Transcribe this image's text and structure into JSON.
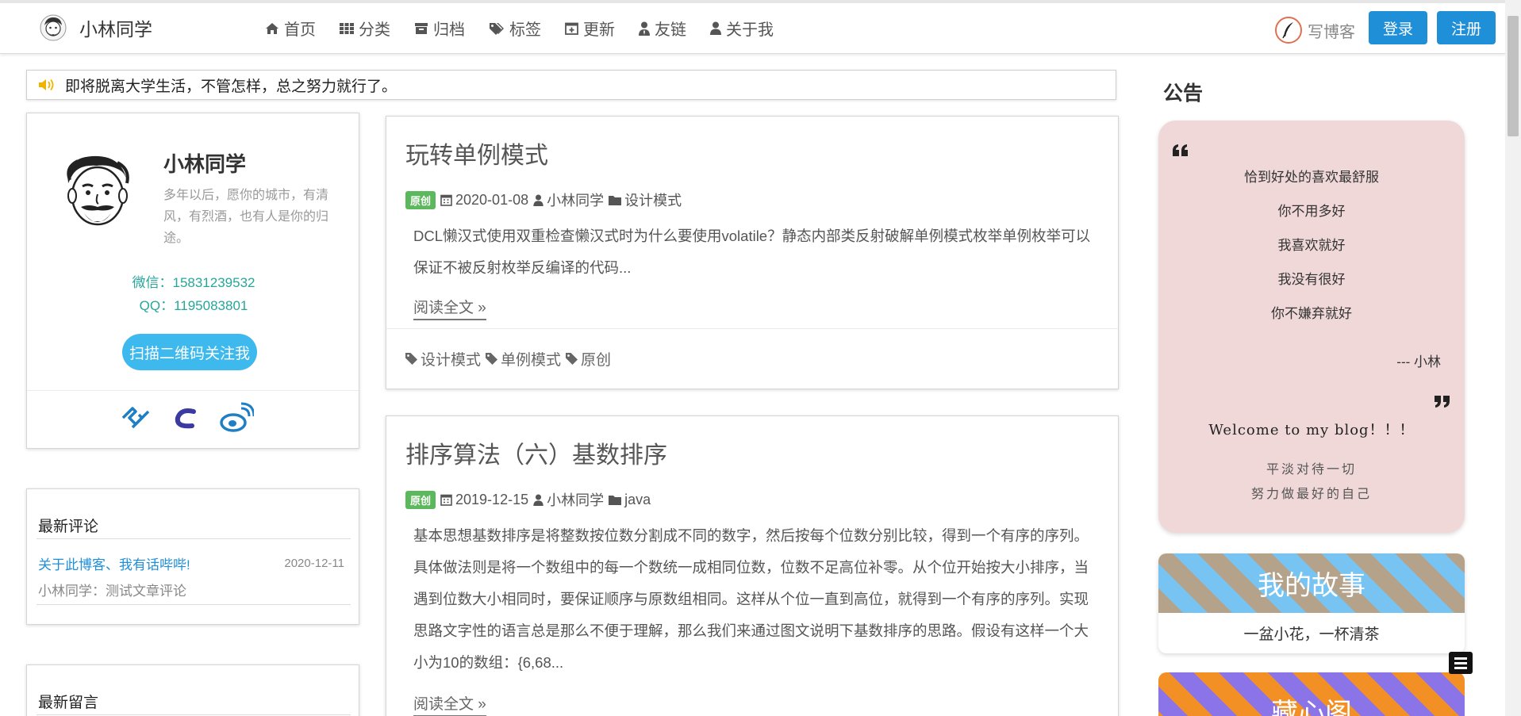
{
  "navbar": {
    "brand": "小林同学",
    "items": [
      {
        "label": "首页",
        "icon": "home-icon"
      },
      {
        "label": "分类",
        "icon": "grid-icon"
      },
      {
        "label": "归档",
        "icon": "archive-icon"
      },
      {
        "label": "标签",
        "icon": "tags-icon"
      },
      {
        "label": "更新",
        "icon": "calendar-plus-icon"
      },
      {
        "label": "友链",
        "icon": "user-tie-icon"
      },
      {
        "label": "关于我",
        "icon": "user-icon"
      }
    ],
    "write_label": "写博客",
    "login_label": "登录",
    "register_label": "注册"
  },
  "notice": {
    "text": "即将脱离大学生活，不管怎样，总之努力就行了。"
  },
  "profile": {
    "name": "小林同学",
    "motto": "多年以后，愿你的城市，有清风，有烈酒，也有人是你的归途。",
    "wechat": "微信：15831239532",
    "qq": "QQ：1195083801",
    "qr_button": "扫描二维码关注我"
  },
  "latest_comments": {
    "title": "最新评论",
    "link": "关于此博客、我有话哔哔!",
    "date": "2020-12-11",
    "text": "小林同学：测试文章评论"
  },
  "latest_messages": {
    "title": "最新留言"
  },
  "posts": [
    {
      "title": "玩转单例模式",
      "badge": "原创",
      "date": "2020-01-08",
      "author": "小林同学",
      "category": "设计模式",
      "excerpt": "DCL懒汉式使用双重检查懒汉式时为什么要使用volatile？静态内部类反射破解单例模式枚举单例枚举可以保证不被反射枚举反编译的代码...",
      "read_more": "阅读全文 »",
      "tags": [
        "设计模式",
        "单例模式",
        "原创"
      ]
    },
    {
      "title": "排序算法（六）基数排序",
      "badge": "原创",
      "date": "2019-12-15",
      "author": "小林同学",
      "category": "java",
      "excerpt": "基本思想基数排序是将整数按位数分割成不同的数字，然后按每个位数分别比较，得到一个有序的序列。具体做法则是将一个数组中的每一个数统一成相同位数，位数不足高位补零。从个位开始按大小排序，当遇到位数大小相同时，要保证顺序与原数组相同。这样从个位一直到高位，就得到一个有序的序列。实现思路文字性的语言总是那么不便于理解，那么我们来通过图文说明下基数排序的思路。假设有这样一个大小为10的数组：{6,68...",
      "read_more": "阅读全文 »"
    }
  ],
  "announcement": {
    "title": "公告",
    "lines": [
      "恰到好处的喜欢最舒服",
      "你不用多好",
      "我喜欢就好",
      "我没有很好",
      "你不嫌弃就好"
    ],
    "author": "--- 小林",
    "welcome": "Welcome to my blog！！！",
    "sub_1": "平淡对待一切",
    "sub_2": "努力做最好的自己"
  },
  "story": {
    "title": "我的故事",
    "subtitle": "一盆小花，一杯清茶"
  },
  "treasure": {
    "title": "藏心阁"
  },
  "colors": {
    "primary": "#1f8fd8",
    "teal": "#26a69a",
    "qr_button": "#3db9ee",
    "badge": "#5cb85c",
    "announce_bg": "#f0d8d8"
  }
}
